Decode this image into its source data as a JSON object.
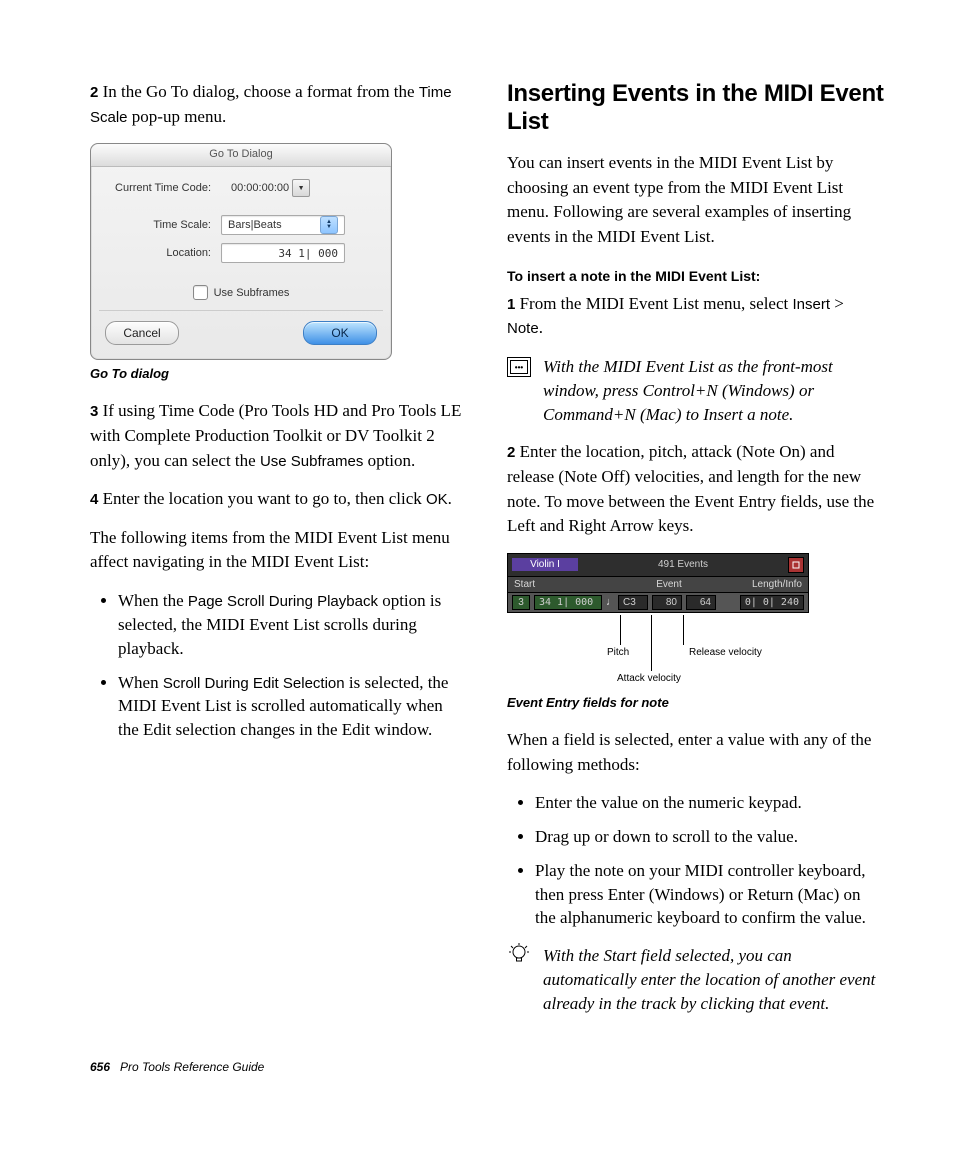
{
  "left": {
    "step2_pre": "In the Go To dialog, choose a format from the ",
    "step2_sans": "Time Scale",
    "step2_post": " pop-up menu.",
    "caption": "Go To dialog",
    "step3_a": "If using Time Code (Pro Tools HD and Pro Tools LE with Complete Production Toolkit or DV Toolkit 2 only), you can select the ",
    "step3_sans": "Use Subframes",
    "step3_b": " option.",
    "step4_a": "Enter the location you want to go to, then click ",
    "step4_sans": "OK",
    "step4_b": ".",
    "navPara": "The following items from the MIDI Event List menu affect navigating in the MIDI Event List:",
    "b1_a": "When the ",
    "b1_sans": "Page Scroll During Playback",
    "b1_b": " option is selected, the MIDI Event List scrolls during playback.",
    "b2_a": "When ",
    "b2_sans": "Scroll During Edit Selection",
    "b2_b": " is selected, the MIDI Event List is scrolled automatically when the Edit selection changes in the Edit window."
  },
  "goto": {
    "title": "Go To Dialog",
    "ctc_label": "Current Time Code:",
    "ctc_value": "00:00:00:00",
    "ts_label": "Time Scale:",
    "ts_value": "Bars|Beats",
    "loc_label": "Location:",
    "loc_value": "34  1| 000",
    "sub_label": "Use Subframes",
    "cancel": "Cancel",
    "ok": "OK"
  },
  "right": {
    "h1": "Inserting Events in the MIDI Event List",
    "intro": "You can insert events in the MIDI Event List by choosing an event type from the MIDI Event List menu. Following are several examples of inserting events in the MIDI Event List.",
    "sub": "To insert a note in the MIDI Event List:",
    "s1_a": "From the MIDI Event List menu, select ",
    "s1_s1": "Insert",
    "s1_mid": " > ",
    "s1_s2": "Note",
    "s1_b": ".",
    "tip1": "With the MIDI Event List as the front-most window, press Control+N (Windows) or Command+N (Mac) to Insert a note.",
    "s2": "Enter the location, pitch, attack (Note On) and release (Note Off) velocities, and length for the new note. To move between the Event Entry fields, use the Left and Right Arrow keys.",
    "caption2": "Event Entry fields for note",
    "after": "When a field is selected, enter a value with any of the following methods:",
    "bl1": "Enter the value on the numeric keypad.",
    "bl2": "Drag up or down to scroll to the value.",
    "bl3": "Play the note on your MIDI controller keyboard, then press Enter (Windows) or Return (Mac) on the alphanumeric keyboard to confirm the value.",
    "tip2": "With the Start field selected, you can automatically enter the location of another event already in the track by clicking that event."
  },
  "mel": {
    "track": "Violin I",
    "events": "491 Events",
    "h_start": "Start",
    "h_event": "Event",
    "h_len": "Length/Info",
    "row_loc_a": "3",
    "row_loc_b": "34  1| 000",
    "row_pitch": "C3",
    "row_a": "80",
    "row_r": "64",
    "row_len": "0| 0| 240",
    "lbl_pitch": "Pitch",
    "lbl_attack": "Attack velocity",
    "lbl_release": "Release velocity"
  },
  "footer": {
    "page": "656",
    "title": "Pro Tools Reference Guide"
  },
  "nums": {
    "n2": "2",
    "n3": "3",
    "n4": "4",
    "n1": "1"
  }
}
